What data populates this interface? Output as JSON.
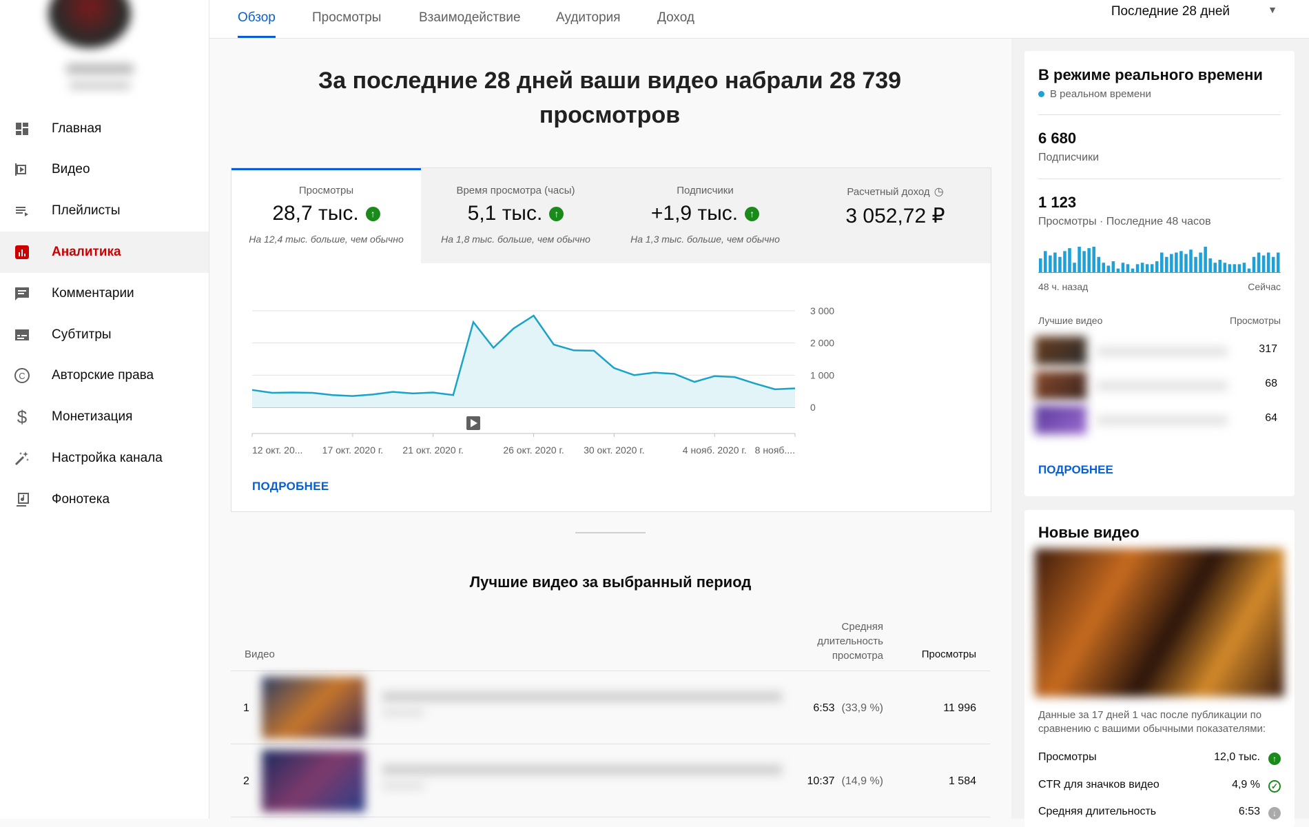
{
  "sidebar": {
    "items": [
      {
        "label": "Главная",
        "icon": "dashboard-icon"
      },
      {
        "label": "Видео",
        "icon": "video-icon"
      },
      {
        "label": "Плейлисты",
        "icon": "playlist-icon"
      },
      {
        "label": "Аналитика",
        "icon": "analytics-icon",
        "active": true
      },
      {
        "label": "Комментарии",
        "icon": "comments-icon"
      },
      {
        "label": "Субтитры",
        "icon": "subtitles-icon"
      },
      {
        "label": "Авторские права",
        "icon": "copyright-icon"
      },
      {
        "label": "Монетизация",
        "icon": "dollar-icon"
      },
      {
        "label": "Настройка канала",
        "icon": "magic-wand-icon"
      },
      {
        "label": "Фонотека",
        "icon": "audio-library-icon"
      }
    ]
  },
  "tabs": [
    "Обзор",
    "Просмотры",
    "Взаимодействие",
    "Аудитория",
    "Доход"
  ],
  "period": {
    "label": "Последние 28 дней"
  },
  "headline": "За последние 28 дней ваши видео набрали 28 739 просмотров",
  "metrics": [
    {
      "label": "Просмотры",
      "value": "28,7 тыс.",
      "note": "На 12,4 тыс. больше, чем обычно",
      "trend": "up"
    },
    {
      "label": "Время просмотра (часы)",
      "value": "5,1 тыс.",
      "note": "На 1,8 тыс. больше, чем обычно",
      "trend": "up"
    },
    {
      "label": "Подписчики",
      "value": "+1,9 тыс.",
      "note": "На 1,3 тыс. больше, чем обычно",
      "trend": "up"
    },
    {
      "label": "Расчетный доход",
      "value": "3 052,72 ₽",
      "note": "",
      "trend": "none"
    }
  ],
  "more_label": "ПОДРОБНЕЕ",
  "chart_data": {
    "type": "area",
    "x": [
      "12 окт.",
      "13 окт.",
      "14 окт.",
      "15 окт.",
      "16 окт.",
      "17 окт.",
      "18 окт.",
      "19 окт.",
      "20 окт.",
      "21 окт.",
      "22 окт.",
      "23 окт.",
      "24 окт.",
      "25 окт.",
      "26 окт.",
      "27 окт.",
      "28 окт.",
      "29 окт.",
      "30 окт.",
      "31 окт.",
      "1 нояб.",
      "2 нояб.",
      "3 нояб.",
      "4 нояб.",
      "5 нояб.",
      "6 нояб.",
      "7 нояб.",
      "8 нояб."
    ],
    "series": [
      {
        "values": [
          540,
          450,
          460,
          450,
          380,
          350,
          400,
          480,
          430,
          460,
          380,
          2650,
          1850,
          2450,
          2850,
          1950,
          1770,
          1760,
          1220,
          1000,
          1080,
          1040,
          790,
          970,
          940,
          740,
          560,
          590
        ]
      }
    ],
    "xtick_labels": [
      "12 окт. 20...",
      "17 окт. 2020 г.",
      "21 окт. 2020 г.",
      "26 окт. 2020 г.",
      "30 окт. 2020 г.",
      "4 нояб. 2020 г.",
      "8 нояб...."
    ],
    "ytick_labels": [
      "3 000",
      "2 000",
      "1 000",
      "0"
    ],
    "ylim": [
      0,
      3000
    ],
    "grid": true,
    "color": "#1aa3c9"
  },
  "top_videos": {
    "title": "Лучшие видео за выбранный период",
    "col_video": "Видео",
    "col_avg": "Средняя длительность просмотра",
    "col_views": "Просмотры",
    "rows": [
      {
        "num": "1",
        "avg": "6:53",
        "pct": "(33,9 %)",
        "views": "11 996"
      },
      {
        "num": "2",
        "avg": "10:37",
        "pct": "(14,9 %)",
        "views": "1 584"
      }
    ]
  },
  "realtime": {
    "title": "В режиме реального времени",
    "live": "В реальном времени",
    "subs_value": "6 680",
    "subs_label": "Подписчики",
    "views_value": "1 123",
    "views_label": "Просмотры · Последние 48 часов",
    "bars": [
      20,
      30,
      24,
      28,
      22,
      30,
      34,
      14,
      36,
      30,
      34,
      36,
      22,
      14,
      10,
      16,
      6,
      14,
      12,
      6,
      12,
      14,
      12,
      12,
      16,
      28,
      22,
      26,
      28,
      30,
      26,
      32,
      22,
      28,
      36,
      20,
      14,
      18,
      14,
      12,
      12,
      12,
      14,
      6,
      22,
      28,
      24,
      28,
      22,
      28
    ],
    "axis_left": "48 ч. назад",
    "axis_right": "Сейчас",
    "top_head": "Лучшие видео",
    "top_views": "Просмотры",
    "videos": [
      {
        "count": "317"
      },
      {
        "count": "68"
      },
      {
        "count": "64"
      }
    ],
    "more": "ПОДРОБНЕЕ",
    "accent": "#1ea0d8"
  },
  "new_videos": {
    "title": "Новые видео",
    "desc": "Данные за 17 дней 1 час после публикации по сравнению с вашими обычными показателями:",
    "rows": [
      {
        "label": "Просмотры",
        "value": "12,0 тыс.",
        "status": "up"
      },
      {
        "label": "CTR для значков видео",
        "value": "4,9 %",
        "status": "ok"
      },
      {
        "label": "Средняя длительность",
        "value": "6:53",
        "status": "neutral"
      }
    ]
  }
}
